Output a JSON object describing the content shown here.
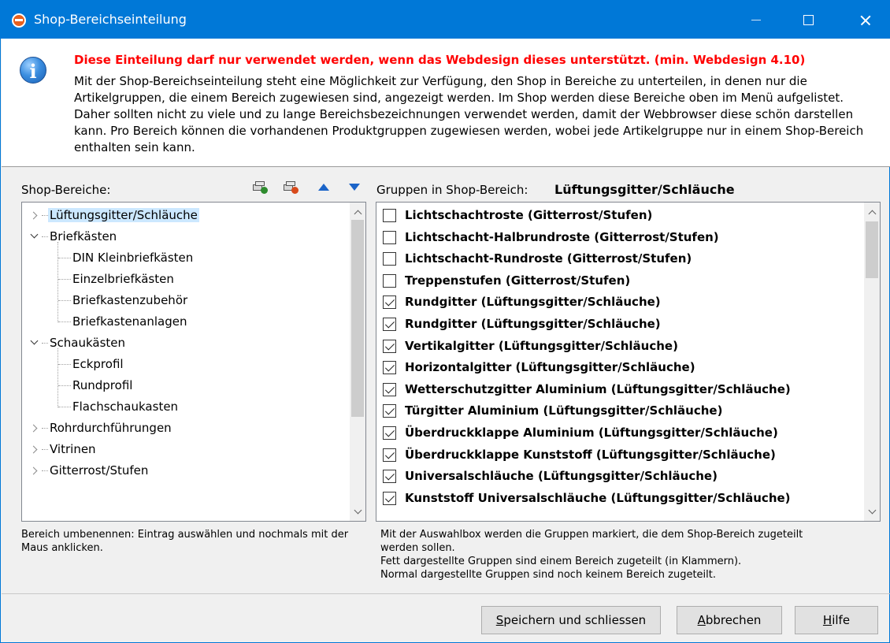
{
  "window": {
    "title": "Shop-Bereichseinteilung",
    "app_icon": "shop-app-icon",
    "controls": [
      "minimize-icon",
      "maximize-icon",
      "close-icon"
    ]
  },
  "info": {
    "icon": "info-icon",
    "warning": "Diese Einteilung darf nur verwendet werden, wenn das Webdesign dieses unterstützt. (min. Webdesign 4.10)",
    "text": "Mit der Shop-Bereichseinteilung steht eine Möglichkeit zur Verfügung, den Shop in Bereiche zu unterteilen, in denen nur die Artikelgruppen, die einem Bereich zugewiesen sind, angezeigt werden. Im Shop werden diese Bereiche oben im Menü aufgelistet. Daher sollten nicht zu viele und zu lange Bereichsbezeichnungen verwendet werden, damit der Webbrowser diese schön darstellen kann. Pro Bereich können die vorhandenen Produktgruppen zugewiesen werden, wobei jede Artikelgruppe nur in einem Shop-Bereich enthalten sein kann.",
    "warning_color": "#ff0000"
  },
  "left": {
    "label": "Shop-Bereiche:",
    "toolbar": [
      "add-area-icon",
      "delete-area-icon",
      "move-up-icon",
      "move-down-icon"
    ],
    "tree": [
      {
        "label": "Lüftungsgitter/Schläuche",
        "state": "collapsed",
        "selected": true,
        "children": []
      },
      {
        "label": "Briefkästen",
        "state": "expanded",
        "children": [
          "DIN Kleinbriefkästen",
          "Einzelbriefkästen",
          "Briefkastenzubehör",
          "Briefkastenanlagen"
        ]
      },
      {
        "label": "Schaukästen",
        "state": "expanded",
        "children": [
          "Eckprofil",
          "Rundprofil",
          "Flachschaukasten"
        ]
      },
      {
        "label": "Rohrdurchführungen",
        "state": "collapsed",
        "children": []
      },
      {
        "label": "Vitrinen",
        "state": "collapsed",
        "children": []
      },
      {
        "label": "Gitterrost/Stufen",
        "state": "collapsed",
        "children": []
      }
    ],
    "note": "Bereich umbenennen: Eintrag auswählen und nochmals mit der Maus anklicken."
  },
  "right": {
    "label": "Gruppen in Shop-Bereich:",
    "area": "Lüftungsgitter/Schläuche",
    "groups": [
      {
        "label": "Lichtschachtroste (Gitterrost/Stufen)",
        "checked": false
      },
      {
        "label": "Lichtschacht-Halbrundroste (Gitterrost/Stufen)",
        "checked": false
      },
      {
        "label": "Lichtschacht-Rundroste (Gitterrost/Stufen)",
        "checked": false
      },
      {
        "label": "Treppenstufen (Gitterrost/Stufen)",
        "checked": false
      },
      {
        "label": "Rundgitter (Lüftungsgitter/Schläuche)",
        "checked": true
      },
      {
        "label": "Rundgitter (Lüftungsgitter/Schläuche)",
        "checked": true
      },
      {
        "label": "Vertikalgitter (Lüftungsgitter/Schläuche)",
        "checked": true
      },
      {
        "label": "Horizontalgitter (Lüftungsgitter/Schläuche)",
        "checked": true
      },
      {
        "label": "Wetterschutzgitter Aluminium (Lüftungsgitter/Schläuche)",
        "checked": true
      },
      {
        "label": "Türgitter Aluminium (Lüftungsgitter/Schläuche)",
        "checked": true
      },
      {
        "label": "Überdruckklappe Aluminium (Lüftungsgitter/Schläuche)",
        "checked": true
      },
      {
        "label": "Überdruckklappe Kunststoff (Lüftungsgitter/Schläuche)",
        "checked": true
      },
      {
        "label": "Universalschläuche (Lüftungsgitter/Schläuche)",
        "checked": true
      },
      {
        "label": "Kunststoff Universalschläuche (Lüftungsgitter/Schläuche)",
        "checked": true
      }
    ],
    "note_lines": [
      "Mit der Auswahlbox werden die Gruppen markiert, die dem Shop-Bereich zugeteilt",
      "werden sollen.",
      "Fett dargestellte Gruppen sind einem Bereich zugeteilt (in Klammern).",
      "Normal dargestellte Gruppen sind noch keinem Bereich zugeteilt."
    ]
  },
  "buttons": {
    "save": {
      "mnemonic": "S",
      "rest": "peichern und schliessen"
    },
    "cancel": {
      "mnemonic": "A",
      "rest": "bbrechen"
    },
    "help": {
      "mnemonic": "H",
      "rest": "ilfe"
    }
  },
  "colors": {
    "titlebar": "#0078d7",
    "selection": "#cce8ff"
  }
}
